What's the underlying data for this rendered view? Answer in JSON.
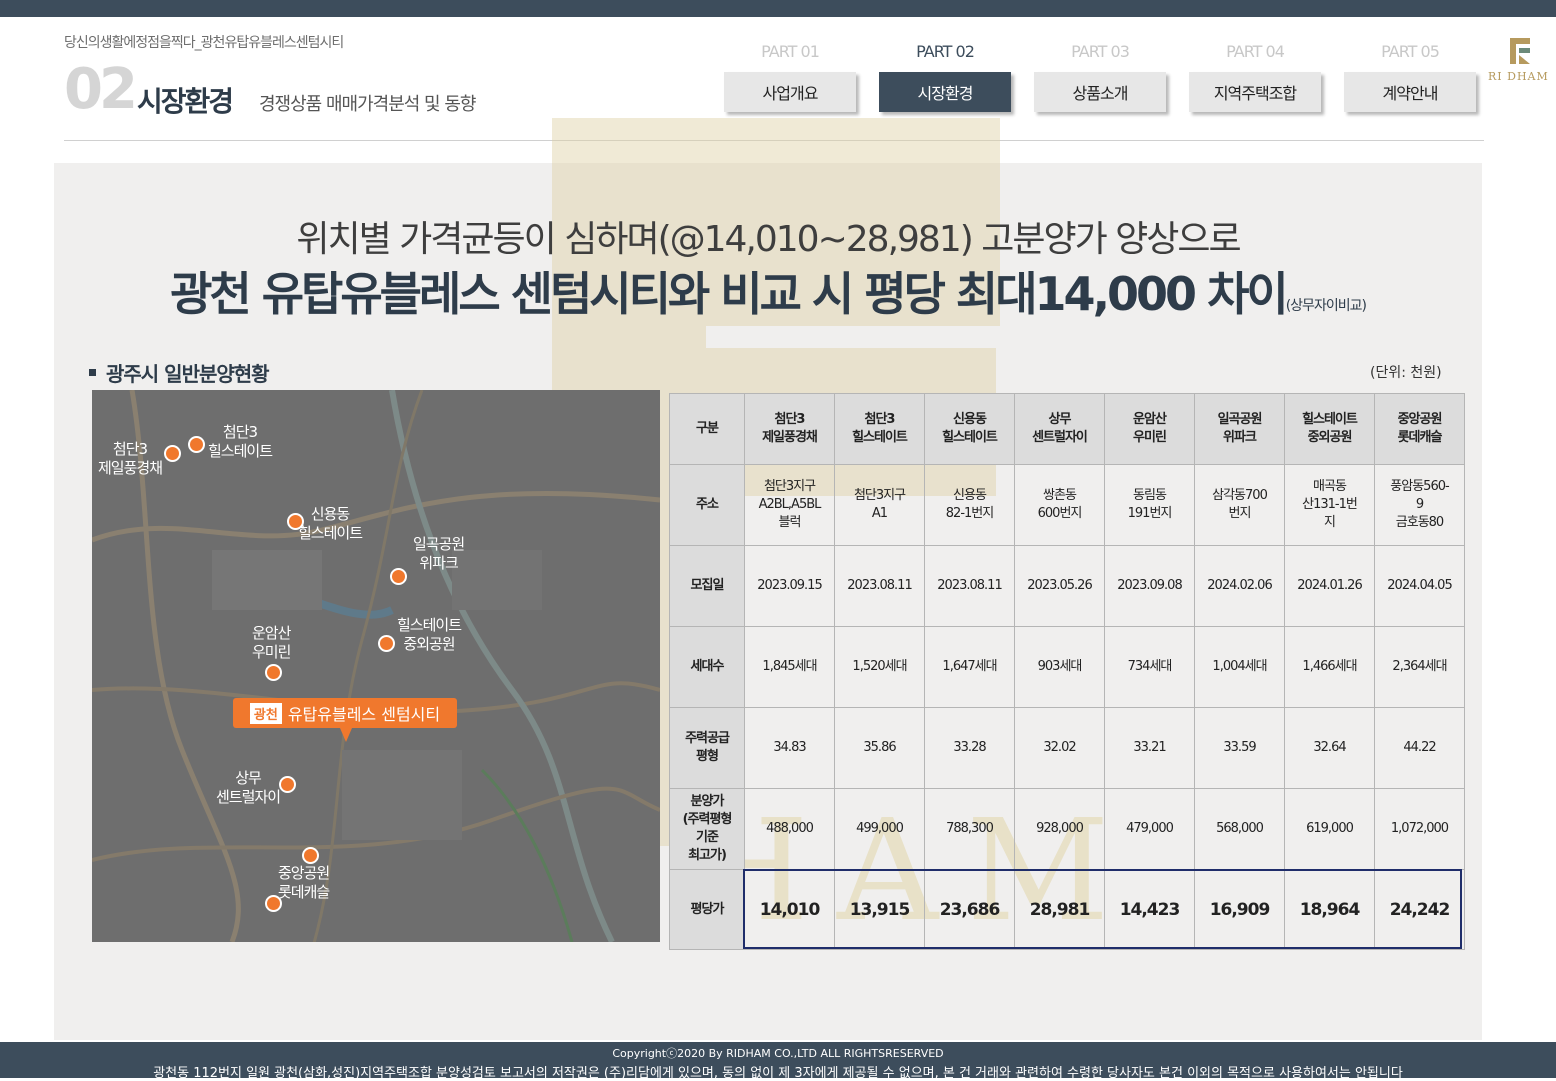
{
  "header": {
    "tagline": "당신의생활에정점을찍다_광천유탑유블레스센텀시티",
    "section_number": "02",
    "section_title": "시장환경",
    "section_subtitle": "경쟁상품 매매가격분석 및 동향",
    "parts": [
      "PART 01",
      "PART 02",
      "PART 03",
      "PART 04",
      "PART 05"
    ],
    "tabs": [
      "사업개요",
      "시장환경",
      "상품소개",
      "지역주택조합",
      "계약안내"
    ],
    "active_index": 1,
    "logo_text": "RI DHAM"
  },
  "headline": {
    "line1": "위치별 가격균등이 심하며(@14,010~28,981) 고분양가 양상으로",
    "line2": "광천 유탑유블레스 센텀시티와 비교 시 평당 최대14,000 차이",
    "line2_note": "(상무자이비교)"
  },
  "section": {
    "list_title": "광주시 일반분양현황",
    "unit": "(단위: 천원)"
  },
  "map": {
    "pins": [
      {
        "label": "첨단3\n제일풍경채"
      },
      {
        "label": "첨단3\n힐스테이트"
      },
      {
        "label": "신용동\n힐스테이트"
      },
      {
        "label": "일곡공원\n위파크"
      },
      {
        "label": "힐스테이트\n중외공원"
      },
      {
        "label": "운암산\n우미린"
      },
      {
        "label": "상무\n센트럴자이"
      },
      {
        "label": "중앙공원\n롯데캐슬"
      }
    ],
    "callout_tag": "광천",
    "callout_text": "유탑유블레스 센텀시티",
    "watermark": "RIDHAM"
  },
  "table": {
    "corner": "구분",
    "columns": [
      "첨단3\n제일풍경채",
      "첨단3\n힐스테이트",
      "신용동\n힐스테이트",
      "상무\n센트럴자이",
      "운암산\n우미린",
      "일곡공원\n위파크",
      "힐스테이트\n중외공원",
      "중앙공원\n롯데캐슬"
    ],
    "rows": [
      {
        "label": "주소",
        "values": [
          "첨단3지구\nA2BL,A5BL\n블럭",
          "첨단3지구\nA1",
          "신용동\n82-1번지",
          "쌍촌동\n600번지",
          "동림동\n191번지",
          "삼각동700\n번지",
          "매곡동\n산131-1번\n지",
          "풍암동560-\n9\n금호동80"
        ]
      },
      {
        "label": "모집일",
        "values": [
          "2023.09.15",
          "2023.08.11",
          "2023.08.11",
          "2023.05.26",
          "2023.09.08",
          "2024.02.06",
          "2024.01.26",
          "2024.04.05"
        ]
      },
      {
        "label": "세대수",
        "values": [
          "1,845세대",
          "1,520세대",
          "1,647세대",
          "903세대",
          "734세대",
          "1,004세대",
          "1,466세대",
          "2,364세대"
        ]
      },
      {
        "label": "주력공급\n평형",
        "values": [
          "34.83",
          "35.86",
          "33.28",
          "32.02",
          "33.21",
          "33.59",
          "32.64",
          "44.22"
        ]
      },
      {
        "label": "분양가\n(주력평형\n기준\n최고가)",
        "values": [
          "488,000",
          "499,000",
          "788,300",
          "928,000",
          "479,000",
          "568,000",
          "619,000",
          "1,072,000"
        ]
      }
    ],
    "price_row": {
      "label": "평당가",
      "values": [
        "14,010",
        "13,915",
        "23,686",
        "28,981",
        "14,423",
        "16,909",
        "18,964",
        "24,242"
      ]
    }
  },
  "footer": {
    "copyright": "Copyrightⓒ2020 By RIDHAM CO.,LTD ALL RIGHTSRESERVED",
    "notice": "광천동 112번지 일원 광천(삼화,성진)지역주택조합 분양성검토 보고서의 저작권은 (주)리담에게 있으며, 동의 없이 제 3자에게 제공될 수 없으며, 본 건 거래와 관련하여 수령한 당사자도 본건 이외의 목적으로 사용하여서는 안됩니다"
  },
  "colors": {
    "navy": "#3d4d5c",
    "accent": "#f0782d",
    "gold": "#b69a5e",
    "highlight_border": "#1f2d6a"
  }
}
